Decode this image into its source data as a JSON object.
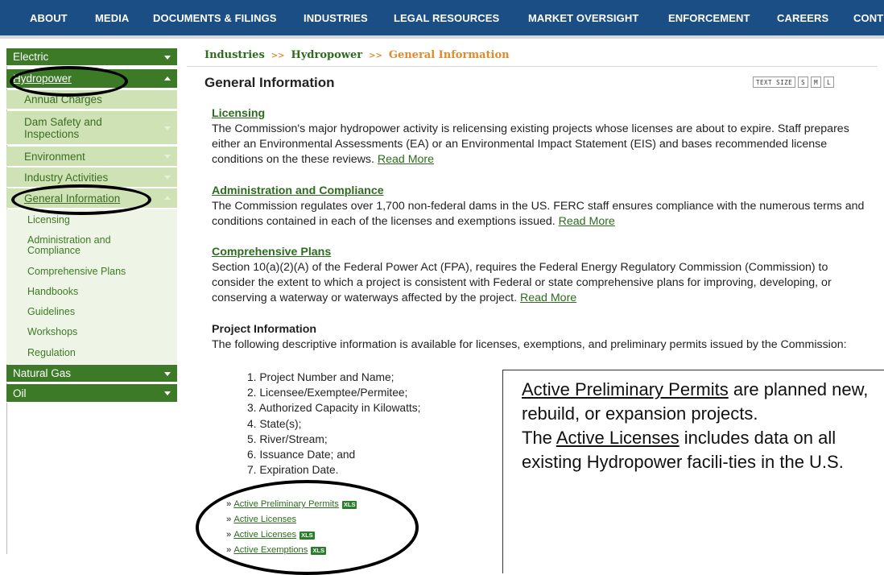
{
  "topnav": {
    "items": [
      "ABOUT",
      "MEDIA",
      "DOCUMENTS & FILINGS",
      "INDUSTRIES",
      "LEGAL RESOURCES",
      "MARKET OVERSIGHT",
      "ENFORCEMENT",
      "CAREERS",
      "CONT"
    ]
  },
  "sidebar": {
    "electric": "Electric",
    "hydropower": "Hydropower",
    "annual_charges": "Annual Charges",
    "dam_safety": "Dam Safety and Inspections",
    "environment": "Environment",
    "industry_activities": "Industry Activities",
    "general_information": "General Information",
    "sub": [
      "Licensing",
      "Administration and Compliance",
      "Comprehensive Plans",
      "Handbooks",
      "Guidelines",
      "Workshops",
      "Regulation"
    ],
    "natural_gas": "Natural Gas",
    "oil": "Oil"
  },
  "breadcrumb": {
    "item1": "Industries",
    "sep": ">>",
    "item2": "Hydropower",
    "current": "General Information"
  },
  "page": {
    "title": "General Information",
    "text_size": {
      "label": "TEXT SIZE",
      "s": "S",
      "m": "M",
      "l": "L"
    }
  },
  "sections": {
    "licensing": {
      "heading": "Licensing",
      "body": "The Commission's major hydropower activity is relicensing existing projects whose licenses are about to expire. Staff prepares either an Environmental Assessments (EA) or an Environmental Impact Statement (EIS) and bases recommended license conditions on the these reviews. ",
      "read_more": "Read More"
    },
    "admin": {
      "heading": "Administration and Compliance",
      "body": "The Commission regulates over 1,700 non-federal dams in the US. FERC staff ensures compliance with the numerous terms and conditions contained in each of the licenses and exemptions issued. ",
      "read_more": "Read More"
    },
    "plans": {
      "heading": "Comprehensive Plans",
      "body": "Section 10(a)(2)(A) of the Federal Power Act (FPA), requires the Federal Energy Regulatory Commission (Commission) to consider the extent to which a project is consistent with Federal or state comprehensive plans for improving, developing, or conserving a waterway or waterways affected by the project. ",
      "read_more": "Read More"
    },
    "project": {
      "heading": "Project Information",
      "body": "The following descriptive information is available for licenses, exemptions, and preliminary permits issued by the Commission:",
      "list": [
        "1. Project Number and Name;",
        "2. Licensee/Exemptee/Permitee;",
        "3. Authorized Capacity in Kilowatts;",
        "4. State(s);",
        "5. River/Stream;",
        "6. Issuance Date; and",
        "7. Expiration Date."
      ]
    }
  },
  "links": {
    "prefix": "»",
    "items": [
      {
        "label": "Active Preliminary Permits",
        "badge": "XLS"
      },
      {
        "label": "Active Licenses",
        "badge": ""
      },
      {
        "label": "Active Licenses",
        "badge": "XLS"
      },
      {
        "label": "Active Exemptions",
        "badge": "XLS"
      }
    ]
  },
  "callout": {
    "p1_link": "Active Preliminary Permits",
    "p1_rest": " are planned new, rebuild, or expansion projects.",
    "p2_pre": "The ",
    "p2_link": "Active Licenses",
    "p2_rest": " includes data on all existing Hydropower facili-ties in the U.S."
  },
  "colors": {
    "nav": "#1c4e86",
    "sidebar_dark": "#3d7a27",
    "sidebar_mid": "#cfe2b5",
    "link": "#2d6c1e",
    "accent": "#e08a2a"
  }
}
